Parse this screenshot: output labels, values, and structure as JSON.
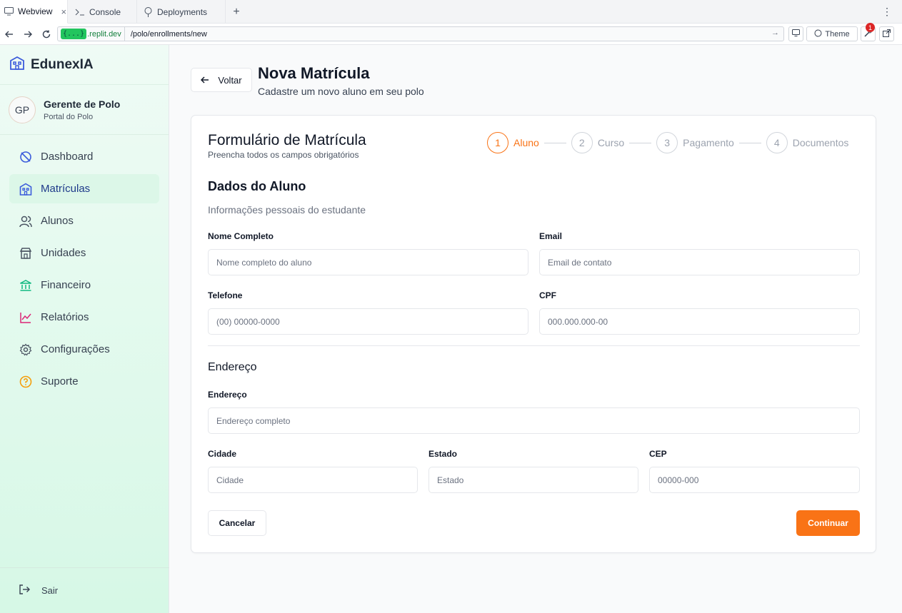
{
  "browser": {
    "tabs": [
      {
        "label": "Webview",
        "icon": "monitor-icon",
        "active": true
      },
      {
        "label": "Console",
        "icon": "terminal-icon",
        "active": false
      },
      {
        "label": "Deployments",
        "icon": "tree-icon",
        "active": false
      }
    ],
    "url_host": ".replit.dev",
    "url_host_pill": "{...}",
    "url_path": "/polo/enrollments/new",
    "theme_label": "Theme",
    "notification_count": "1"
  },
  "sidebar": {
    "brand": "EdunexIA",
    "profile": {
      "initials": "GP",
      "name": "Gerente de Polo",
      "subtitle": "Portal do Polo"
    },
    "items": [
      {
        "label": "Dashboard",
        "icon": "dashboard-icon",
        "color": "#3b5bdb"
      },
      {
        "label": "Matrículas",
        "icon": "building-icon",
        "color": "#3b5bdb",
        "active": true
      },
      {
        "label": "Alunos",
        "icon": "users-icon",
        "color": "#4b5563"
      },
      {
        "label": "Unidades",
        "icon": "store-icon",
        "color": "#4b5563"
      },
      {
        "label": "Financeiro",
        "icon": "bank-icon",
        "color": "#10b981"
      },
      {
        "label": "Relatórios",
        "icon": "chart-icon",
        "color": "#db2777"
      },
      {
        "label": "Configurações",
        "icon": "gear-icon",
        "color": "#4b5563"
      },
      {
        "label": "Suporte",
        "icon": "help-icon",
        "color": "#f59e0b"
      }
    ],
    "logout": "Sair"
  },
  "header": {
    "back": "Voltar",
    "title": "Nova Matrícula",
    "subtitle": "Cadastre um novo aluno em seu polo"
  },
  "form": {
    "title": "Formulário de Matrícula",
    "subtitle": "Preencha todos os campos obrigatórios",
    "steps": [
      {
        "num": "1",
        "label": "Aluno",
        "active": true
      },
      {
        "num": "2",
        "label": "Curso",
        "active": false
      },
      {
        "num": "3",
        "label": "Pagamento",
        "active": false
      },
      {
        "num": "4",
        "label": "Documentos",
        "active": false
      }
    ],
    "section_student": {
      "title": "Dados do Aluno",
      "description": "Informações pessoais do estudante"
    },
    "fields": {
      "name": {
        "label": "Nome Completo",
        "placeholder": "Nome completo do aluno",
        "value": ""
      },
      "email": {
        "label": "Email",
        "placeholder": "Email de contato",
        "value": ""
      },
      "phone": {
        "label": "Telefone",
        "placeholder": "(00) 00000-0000",
        "value": ""
      },
      "cpf": {
        "label": "CPF",
        "placeholder": "000.000.000-00",
        "value": ""
      },
      "address": {
        "label": "Endereço",
        "placeholder": "Endereço completo",
        "value": ""
      },
      "city": {
        "label": "Cidade",
        "placeholder": "Cidade",
        "value": ""
      },
      "state": {
        "label": "Estado",
        "placeholder": "Estado",
        "value": ""
      },
      "cep": {
        "label": "CEP",
        "placeholder": "00000-000",
        "value": ""
      }
    },
    "section_address": {
      "title": "Endereço"
    },
    "cancel": "Cancelar",
    "continue": "Continuar"
  },
  "colors": {
    "accent": "#f97316",
    "sidebar_bg": "#dcf7e8",
    "active_text": "#1e3a8a"
  }
}
